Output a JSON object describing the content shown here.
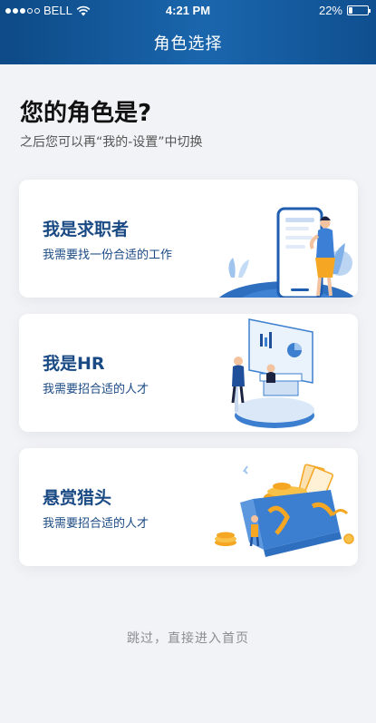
{
  "status_bar": {
    "carrier": "BELL",
    "time": "4:21 PM",
    "battery": "22%",
    "battery_level": 0.22,
    "signal_bars_filled": 3,
    "signal_bars_total": 5
  },
  "nav": {
    "title": "角色选择"
  },
  "page": {
    "heading": "您的角色是?",
    "subheading": "之后您可以再“我的-设置”中切换"
  },
  "roles": [
    {
      "title": "我是求职者",
      "desc": "我需要找一份合适的工作",
      "icon": "phone-person-illustration"
    },
    {
      "title": "我是HR",
      "desc": "我需要招合适的人才",
      "icon": "office-presentation-illustration"
    },
    {
      "title": "悬赏猎头",
      "desc": "我需要招合适的人才",
      "icon": "gift-box-coins-illustration"
    }
  ],
  "skip_label": "跳过，直接进入首页",
  "colors": {
    "header_start": "#0d4a86",
    "header_end": "#1a66ad",
    "accent": "#1a4a84",
    "background": "#f2f3f6",
    "gold": "#f5a623"
  }
}
